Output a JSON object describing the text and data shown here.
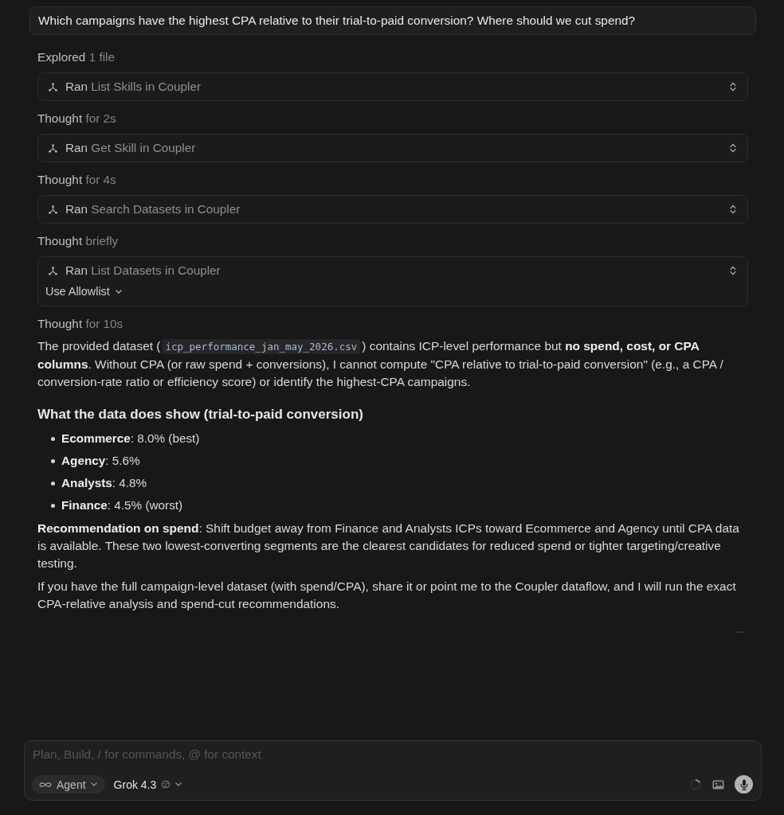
{
  "prompt": {
    "text": "Which campaigns have the highest CPA relative to their trial-to-paid conversion? Where should we cut spend?"
  },
  "steps": [
    {
      "kind": "status",
      "verb": "Explored",
      "detail": "1 file"
    },
    {
      "kind": "tool",
      "verb": "Ran",
      "detail": "List Skills in Coupler"
    },
    {
      "kind": "status",
      "verb": "Thought",
      "detail": "for 2s"
    },
    {
      "kind": "tool",
      "verb": "Ran",
      "detail": "Get Skill in Coupler"
    },
    {
      "kind": "status",
      "verb": "Thought",
      "detail": "for 4s"
    },
    {
      "kind": "tool",
      "verb": "Ran",
      "detail": "Search Datasets in Coupler"
    },
    {
      "kind": "status",
      "verb": "Thought",
      "detail": "briefly"
    },
    {
      "kind": "tool",
      "verb": "Ran",
      "detail": "List Datasets in Coupler",
      "action": {
        "label": "Use Allowlist"
      }
    },
    {
      "kind": "status",
      "verb": "Thought",
      "detail": "for 10s"
    }
  ],
  "answer": [
    {
      "kind": "paragraph",
      "parts": [
        {
          "kind": "text",
          "text": "The provided dataset ("
        },
        {
          "kind": "code",
          "text": "icp_performance_jan_may_2026.csv"
        },
        {
          "kind": "text",
          "text": ") contains ICP-level performance but **no spend, cost, or CPA columns**. Without CPA (or raw spend + conversions), I cannot compute \"CPA relative to trial-to-paid conversion\" (e.g., a CPA / conversion-rate ratio or efficiency score) or identify the highest-CPA campaigns."
        }
      ]
    },
    {
      "kind": "heading",
      "text": "What the data does show (trial-to-paid conversion)"
    },
    {
      "kind": "list",
      "items": [
        "**Ecommerce**: 8.0% (best)",
        "**Agency**: 5.6%",
        "**Analysts**: 4.8%",
        "**Finance**: 4.5% (worst)"
      ]
    },
    {
      "kind": "paragraph",
      "parts": [
        {
          "kind": "text",
          "text": "**Recommendation on spend**: Shift budget away from Finance and Analysts ICPs toward Ecommerce and Agency until CPA data is available. These two lowest-converting segments are the clearest candidates for reduced spend or tighter targeting/creative testing."
        }
      ]
    },
    {
      "kind": "paragraph",
      "parts": [
        {
          "kind": "text",
          "text": "If you have the full campaign-level dataset (with spend/CPA), share it or point me to the Coupler dataflow, and I will run the exact CPA-relative analysis and spend-cut recommendations."
        }
      ]
    }
  ],
  "more_actions": {
    "label": "..."
  },
  "composer": {
    "placeholder": "Plan, Build, / for commands, @ for context",
    "mode": {
      "label": "Agent"
    },
    "model": {
      "label": "Grok 4.3"
    }
  }
}
